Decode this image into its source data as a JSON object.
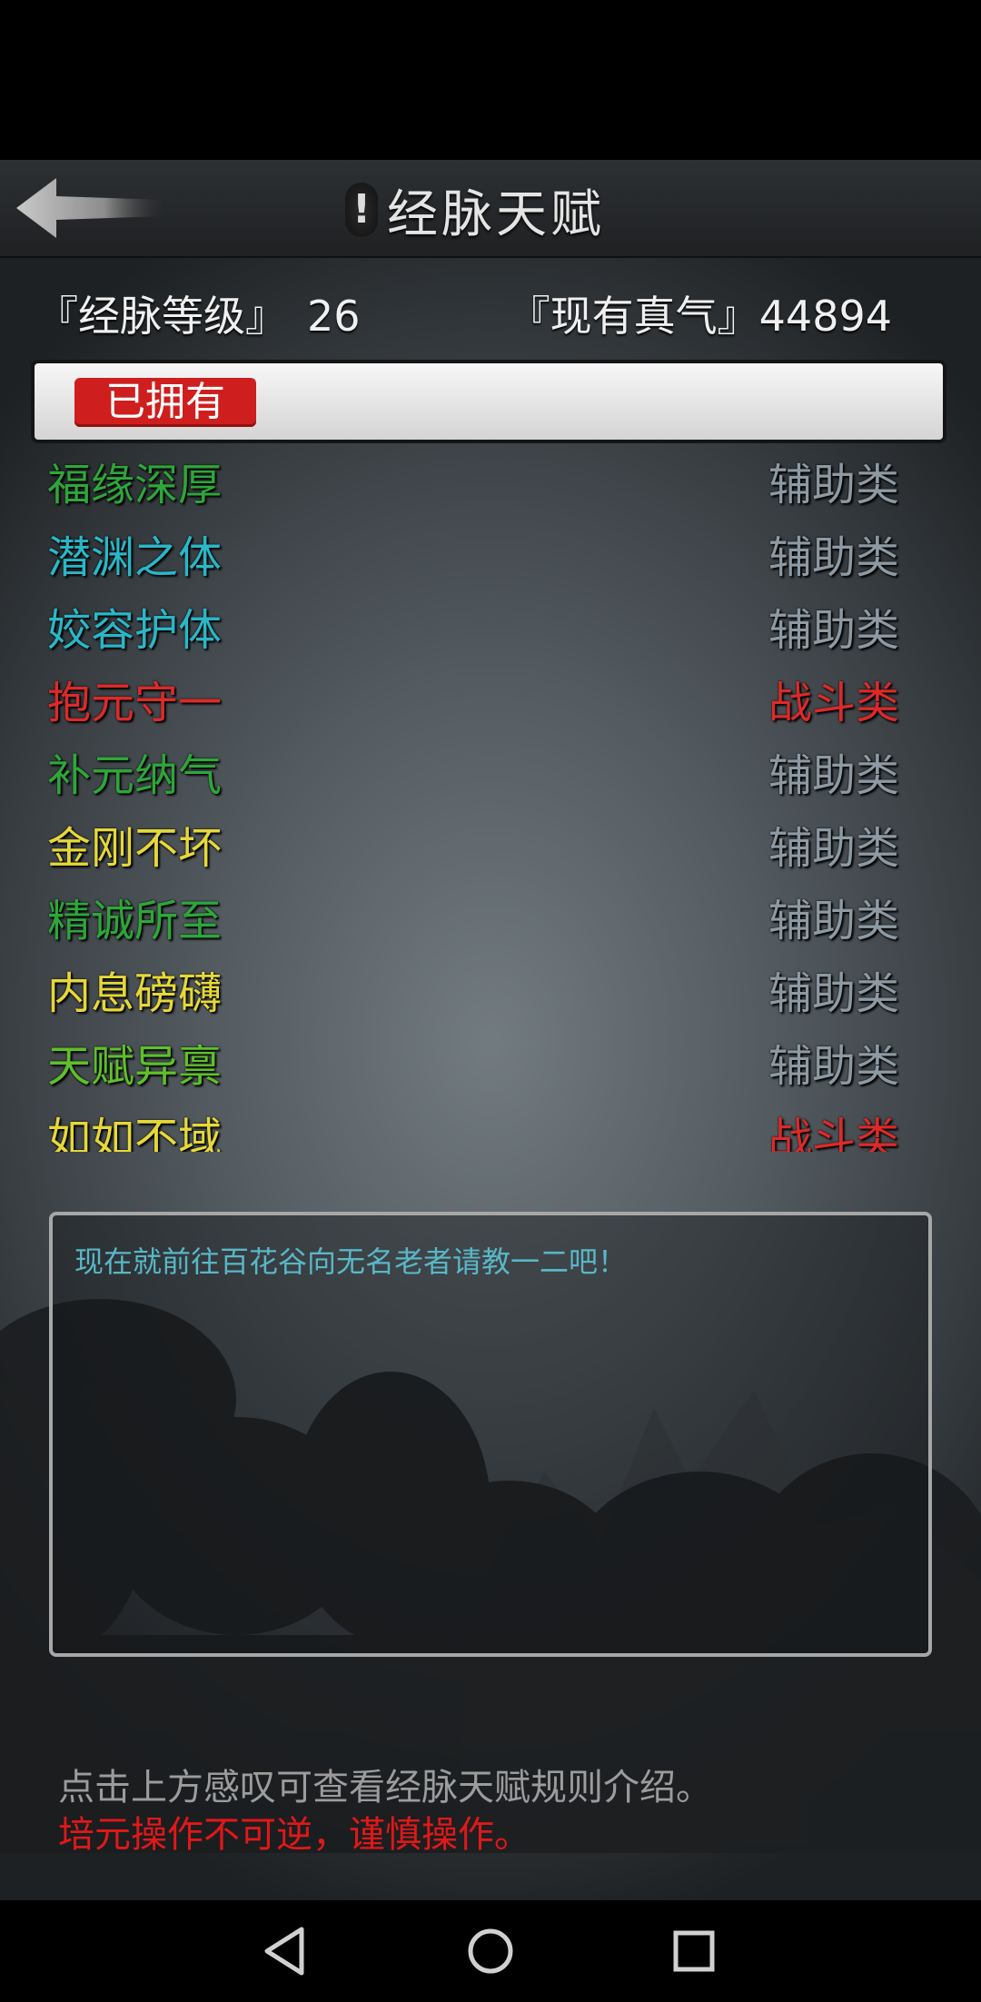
{
  "header": {
    "title": "经脉天赋",
    "info_glyph": "!"
  },
  "stats": {
    "level_label": "『经脉等级』",
    "level_value": "26",
    "qi_label": "『现有真气』",
    "qi_value": "44894"
  },
  "tabs": {
    "owned_label": "已拥有"
  },
  "talents": [
    {
      "name": "福缘深厚",
      "category": "辅助类",
      "name_color": "green",
      "category_color": "gray"
    },
    {
      "name": "潜渊之体",
      "category": "辅助类",
      "name_color": "cyan",
      "category_color": "gray"
    },
    {
      "name": "姣容护体",
      "category": "辅助类",
      "name_color": "cyan",
      "category_color": "gray"
    },
    {
      "name": "抱元守一",
      "category": "战斗类",
      "name_color": "red",
      "category_color": "red"
    },
    {
      "name": "补元纳气",
      "category": "辅助类",
      "name_color": "green",
      "category_color": "gray"
    },
    {
      "name": "金刚不坏",
      "category": "辅助类",
      "name_color": "yellow",
      "category_color": "gray"
    },
    {
      "name": "精诚所至",
      "category": "辅助类",
      "name_color": "green",
      "category_color": "gray"
    },
    {
      "name": "内息磅礴",
      "category": "辅助类",
      "name_color": "yellow",
      "category_color": "gray"
    },
    {
      "name": "天赋异禀",
      "category": "辅助类",
      "name_color": "lime",
      "category_color": "gray"
    },
    {
      "name": "如如不域",
      "category": "战斗类",
      "name_color": "yellow",
      "category_color": "red"
    }
  ],
  "description": {
    "text": "现在就前往百花谷向无名老者请教一二吧！"
  },
  "notes": {
    "line1": "点击上方感叹可查看经脉天赋规则介绍。",
    "line2": "培元操作不可逆，谨慎操作。"
  },
  "colors": {
    "tab_red": "#cf1e1e",
    "name_green": "#2ea63a",
    "name_cyan": "#2ab7c8",
    "name_red": "#dc2a2a",
    "name_yellow": "#e6d838",
    "name_lime": "#5fc02a",
    "category_gray": "#8d9aa3",
    "desc_text": "#58b7c7",
    "warning_red": "#e01818"
  },
  "icons": {
    "back": "arrow-left-icon",
    "info": "exclamation-icon",
    "nav_back": "triangle-back-icon",
    "nav_home": "circle-home-icon",
    "nav_recent": "square-recent-icon"
  }
}
